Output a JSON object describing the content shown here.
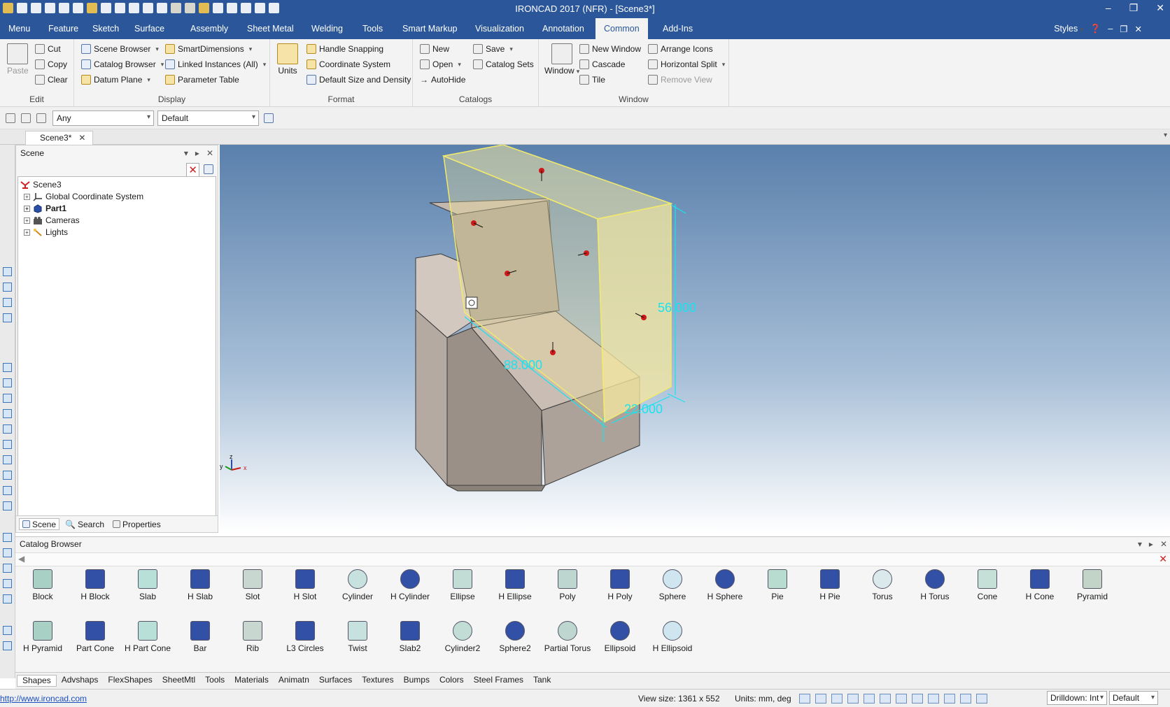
{
  "window": {
    "title": "IRONCAD 2017 (NFR) - [Scene3*]"
  },
  "ribbon_tabs": [
    "Menu",
    "Feature",
    "Sketch",
    "Surface",
    "Assembly",
    "Sheet Metal",
    "Welding",
    "Tools",
    "Smart Markup",
    "Visualization",
    "Annotation",
    "Common",
    "Add-Ins"
  ],
  "active_tab": "Common",
  "ribbon_right": {
    "styles": "Styles"
  },
  "groups": {
    "edit": {
      "label": "Edit",
      "paste": "Paste",
      "cut": "Cut",
      "copy": "Copy",
      "clear": "Clear"
    },
    "display": {
      "label": "Display",
      "scene_browser": "Scene Browser",
      "catalog_browser": "Catalog Browser",
      "datum_plane": "Datum Plane",
      "smart_dimensions": "SmartDimensions",
      "linked_instances": "Linked Instances (All)",
      "parameter_table": "Parameter Table"
    },
    "format": {
      "label": "Format",
      "units": "Units",
      "handle_snapping": "Handle Snapping",
      "coordinate_system": "Coordinate System",
      "default_size_density": "Default Size and Density"
    },
    "catalogs": {
      "label": "Catalogs",
      "new": "New",
      "open": "Open",
      "autohide": "AutoHide",
      "save": "Save",
      "catalog_sets": "Catalog Sets"
    },
    "window": {
      "label": "Window",
      "window": "Window",
      "new_window": "New Window",
      "cascade": "Cascade",
      "tile": "Tile",
      "arrange_icons": "Arrange Icons",
      "horizontal_split": "Horizontal Split",
      "remove_view": "Remove View"
    }
  },
  "filterbar": {
    "selection_filter": "Any",
    "style": "Default"
  },
  "doc_tab": "Scene3*",
  "scene_panel": {
    "title": "Scene",
    "tree": [
      {
        "label": "Scene3",
        "bold": false
      },
      {
        "label": "Global Coordinate System",
        "bold": false
      },
      {
        "label": "Part1",
        "bold": true
      },
      {
        "label": "Cameras",
        "bold": false
      },
      {
        "label": "Lights",
        "bold": false
      }
    ],
    "tabs": [
      "Scene",
      "Search",
      "Properties"
    ]
  },
  "viewport": {
    "dimensions": [
      "56.000",
      "88.000",
      "22.000"
    ],
    "triad": {
      "z": "z",
      "y": "y",
      "x": "x"
    }
  },
  "catalog": {
    "title": "Catalog Browser",
    "shapes_row1": [
      "Block",
      "H Block",
      "Slab",
      "H Slab",
      "Slot",
      "H Slot",
      "Cylinder",
      "H Cylinder",
      "Ellipse",
      "H Ellipse",
      "Poly",
      "H Poly",
      "Sphere",
      "H Sphere",
      "Pie",
      "H Pie",
      "Torus",
      "H Torus",
      "Cone",
      "H Cone",
      "Pyramid"
    ],
    "shapes_row2": [
      "H Pyramid",
      "Part Cone",
      "H Part Cone",
      "Bar",
      "Rib",
      "L3 Circles",
      "Twist",
      "Slab2",
      "Cylinder2",
      "Sphere2",
      "Partial Torus",
      "Ellipsoid",
      "H Ellipsoid"
    ],
    "tabs": [
      "Shapes",
      "Advshaps",
      "FlexShapes",
      "SheetMtl",
      "Tools",
      "Materials",
      "Animatn",
      "Surfaces",
      "Textures",
      "Bumps",
      "Colors",
      "Steel Frames",
      "Tank"
    ]
  },
  "status": {
    "url": "http://www.ironcad.com",
    "view_size": "View size: 1361 x  552",
    "units": "Units: mm, deg",
    "drilldown": "Drilldown: Int",
    "style": "Default"
  },
  "colors": {
    "ribbon_blue": "#2b579a",
    "dimension": "#19e3ef",
    "part": "#b9aca3",
    "box": "#f3e7a0"
  }
}
